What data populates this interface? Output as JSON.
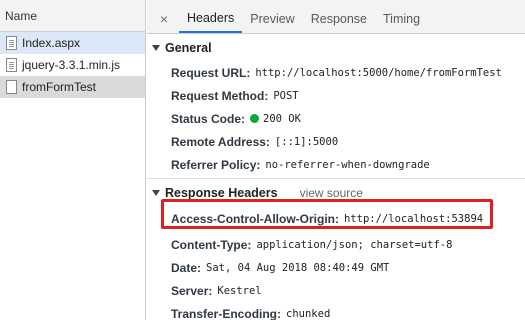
{
  "files_panel": {
    "header": "Name",
    "files": [
      {
        "name": "Index.aspx"
      },
      {
        "name": "jquery-3.3.1.min.js"
      },
      {
        "name": "fromFormTest"
      }
    ]
  },
  "tabs": {
    "close": "×",
    "items": [
      "Headers",
      "Preview",
      "Response",
      "Timing"
    ],
    "active": "Headers"
  },
  "general": {
    "title": "General",
    "request_url_label": "Request URL:",
    "request_url": "http://localhost:5000/home/fromFormTest",
    "method_label": "Request Method:",
    "method": "POST",
    "status_label": "Status Code:",
    "status": "200 OK",
    "status_color": "#0ca63a",
    "remote_label": "Remote Address:",
    "remote": "[::1]:5000",
    "referrer_label": "Referrer Policy:",
    "referrer": "no-referrer-when-downgrade"
  },
  "response_headers": {
    "title": "Response Headers",
    "view_source": "view source",
    "acao_label": "Access-Control-Allow-Origin:",
    "acao": "http://localhost:53894",
    "content_type_label": "Content-Type:",
    "content_type": "application/json; charset=utf-8",
    "date_label": "Date:",
    "date": "Sat, 04 Aug 2018 08:40:49 GMT",
    "server_label": "Server:",
    "server": "Kestrel",
    "te_label": "Transfer-Encoding:",
    "te": "chunked"
  },
  "colors": {
    "highlight": "#e02020",
    "active_tab": "#1a73e8"
  }
}
